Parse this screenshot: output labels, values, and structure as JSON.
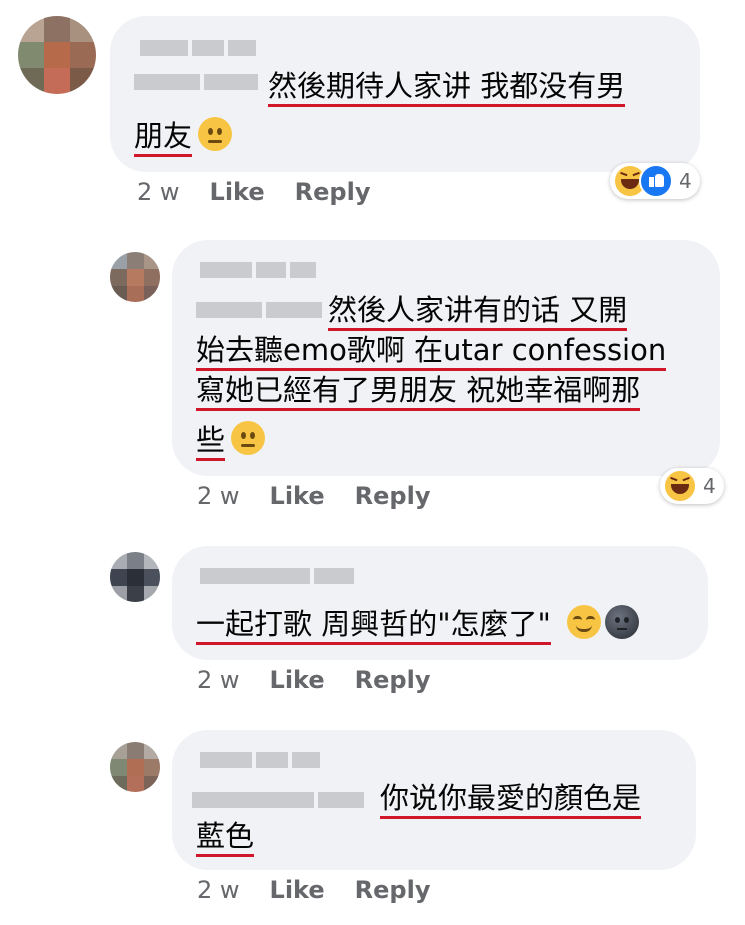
{
  "comments": [
    {
      "lines": [
        "然後期待人家讲  我都没有男",
        "朋友"
      ],
      "emoji": "neutral-face-icon",
      "time": "2 w",
      "like": "Like",
      "reply": "Reply",
      "reaction_count": "4",
      "reactions": [
        "haha-reaction-icon",
        "like-reaction-icon"
      ]
    },
    {
      "lines": [
        "然後人家讲有的话  又開",
        "始去聽emo歌啊 在utar confession",
        "寫她已經有了男朋友 祝她幸福啊那",
        "些"
      ],
      "emoji": "neutral-face-icon",
      "time": "2 w",
      "like": "Like",
      "reply": "Reply",
      "reaction_count": "4",
      "reactions": [
        "haha-reaction-icon"
      ]
    },
    {
      "lines": [
        "一起打歌 周興哲的\"怎麼了\""
      ],
      "emojis": [
        "relieved-face-icon",
        "new-moon-face-icon"
      ],
      "time": "2 w",
      "like": "Like",
      "reply": "Reply"
    },
    {
      "lines": [
        "你说你最愛的顏色是",
        "藍色"
      ],
      "time": "2 w",
      "like": "Like",
      "reply": "Reply"
    }
  ]
}
